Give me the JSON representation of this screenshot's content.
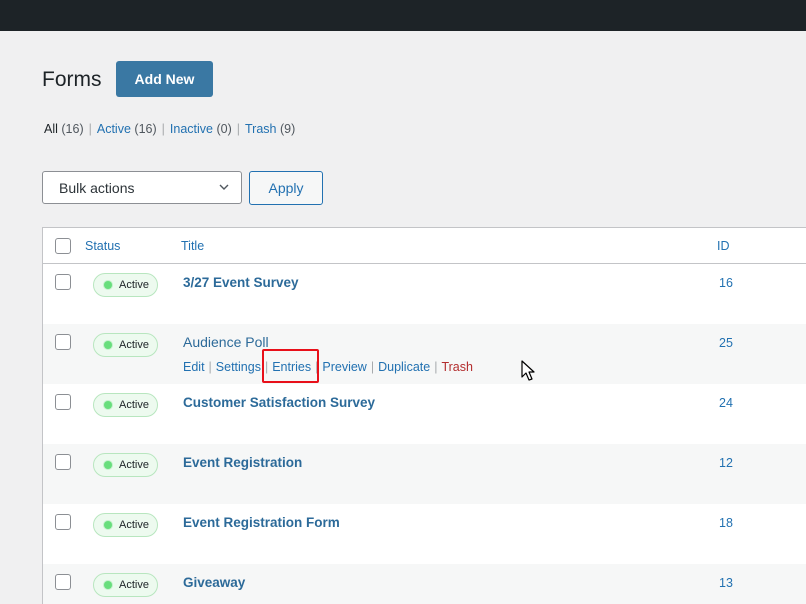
{
  "header": {
    "title": "Forms",
    "add_new_label": "Add New"
  },
  "filters": [
    {
      "label": "All",
      "count": "(16)"
    },
    {
      "label": "Active",
      "count": "(16)"
    },
    {
      "label": "Inactive",
      "count": "(0)"
    },
    {
      "label": "Trash",
      "count": "(9)"
    }
  ],
  "bulk": {
    "selected": "Bulk actions",
    "apply_label": "Apply"
  },
  "columns": {
    "status": "Status",
    "title": "Title",
    "id": "ID"
  },
  "rows": [
    {
      "status": "Active",
      "title": "3/27 Event Survey",
      "id": "16"
    },
    {
      "status": "Active",
      "title": "Audience Poll",
      "id": "25"
    },
    {
      "status": "Active",
      "title": "Customer Satisfaction Survey",
      "id": "24"
    },
    {
      "status": "Active",
      "title": "Event Registration",
      "id": "12"
    },
    {
      "status": "Active",
      "title": "Event Registration Form",
      "id": "18"
    },
    {
      "status": "Active",
      "title": "Giveaway",
      "id": "13"
    }
  ],
  "row_actions": [
    "Edit",
    "Settings",
    "Entries",
    "Preview",
    "Duplicate",
    "Trash"
  ],
  "colors": {
    "admin_bar": "#1d2327",
    "primary": "#3a78a3",
    "link": "#2271b1",
    "active_badge_bg": "#edfaef",
    "trash": "#b32d2e",
    "highlight": "#e8101a"
  }
}
